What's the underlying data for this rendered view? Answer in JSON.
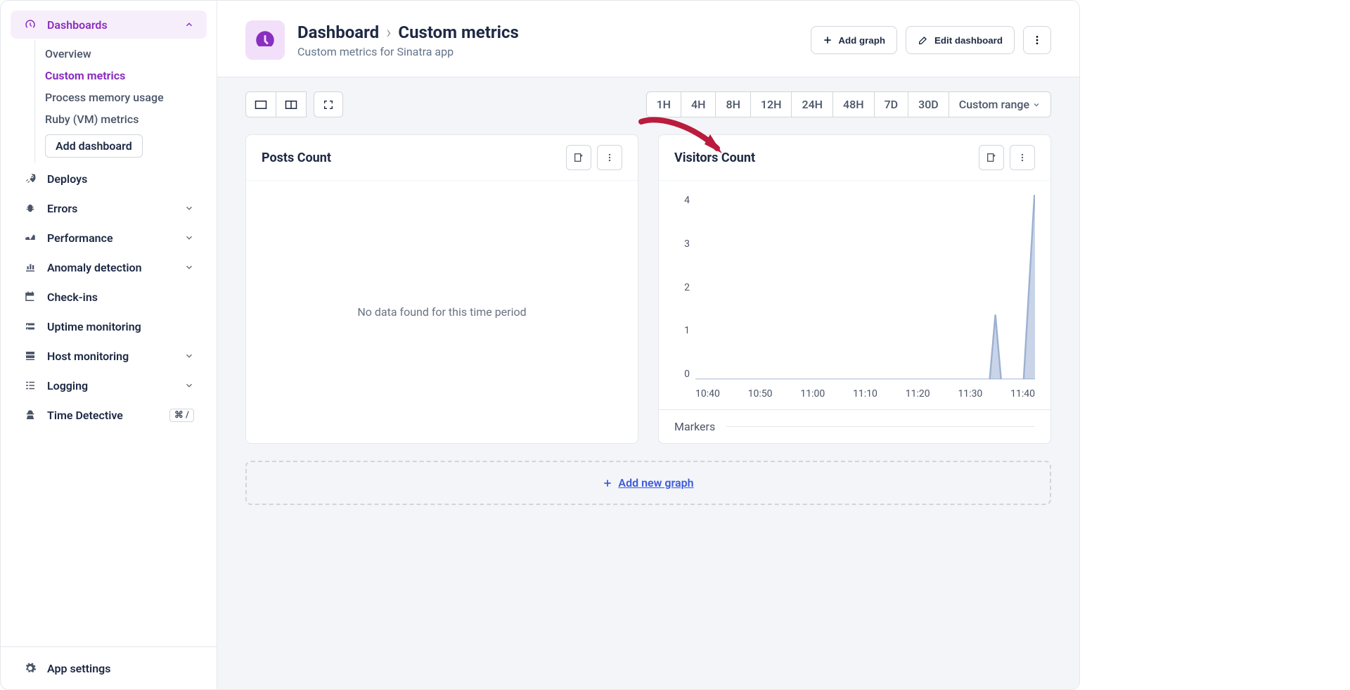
{
  "sidebar": {
    "dashboards": {
      "label": "Dashboards",
      "expanded": true
    },
    "dashboards_sub": [
      {
        "label": "Overview",
        "active": false
      },
      {
        "label": "Custom metrics",
        "active": true
      },
      {
        "label": "Process memory usage",
        "active": false
      },
      {
        "label": "Ruby (VM) metrics",
        "active": false
      }
    ],
    "add_dashboard": "Add dashboard",
    "items": [
      {
        "label": "Deploys"
      },
      {
        "label": "Errors",
        "chev": true
      },
      {
        "label": "Performance",
        "chev": true
      },
      {
        "label": "Anomaly detection",
        "chev": true
      },
      {
        "label": "Check-ins"
      },
      {
        "label": "Uptime monitoring"
      },
      {
        "label": "Host monitoring",
        "chev": true
      },
      {
        "label": "Logging",
        "chev": true
      },
      {
        "label": "Time Detective",
        "kbd": "⌘ /"
      }
    ],
    "footer": {
      "label": "App settings"
    }
  },
  "header": {
    "breadcrumb_root": "Dashboard",
    "breadcrumb_leaf": "Custom metrics",
    "subtitle": "Custom metrics for Sinatra app",
    "add_graph": "Add graph",
    "edit_dashboard": "Edit dashboard"
  },
  "time_ranges": [
    "1H",
    "4H",
    "8H",
    "12H",
    "24H",
    "48H",
    "7D",
    "30D"
  ],
  "custom_range": "Custom range",
  "panels": {
    "posts": {
      "title": "Posts Count",
      "empty": "No data found for this time period"
    },
    "visitors": {
      "title": "Visitors Count",
      "markers": "Markers"
    }
  },
  "add_new_graph": "Add new graph",
  "chart_data": {
    "type": "area",
    "title": "Visitors Count",
    "ylabel": "",
    "xlabel": "",
    "ylim": [
      0,
      4
    ],
    "y_ticks": [
      0,
      1,
      2,
      3,
      4
    ],
    "x_ticks": [
      "10:40",
      "10:50",
      "11:00",
      "11:10",
      "11:20",
      "11:30",
      "11:40"
    ],
    "series": [
      {
        "name": "Visitors",
        "x": [
          "10:40",
          "10:45",
          "10:50",
          "10:55",
          "11:00",
          "11:05",
          "11:10",
          "11:15",
          "11:20",
          "11:25",
          "11:30",
          "11:32",
          "11:33",
          "11:34",
          "11:36",
          "11:38",
          "11:40",
          "11:41"
        ],
        "values": [
          0,
          0,
          0,
          0,
          0,
          0,
          0,
          0,
          0,
          0,
          0,
          0,
          1.4,
          0,
          0,
          0,
          4.2,
          0
        ]
      }
    ]
  }
}
